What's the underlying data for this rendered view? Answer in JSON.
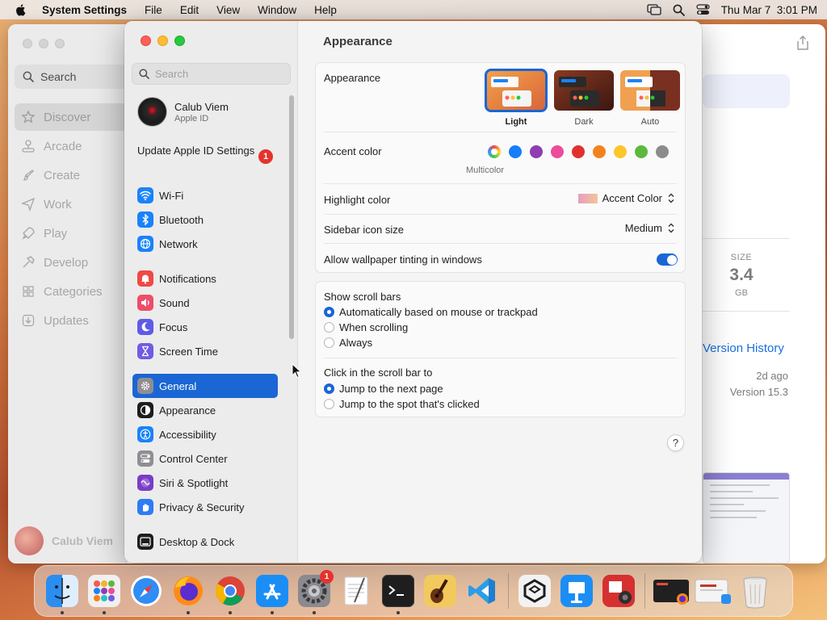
{
  "menubar": {
    "app_name": "System Settings",
    "menus": [
      "File",
      "Edit",
      "View",
      "Window",
      "Help"
    ],
    "clock": "Thu Mar 7  3:01 PM"
  },
  "appstore": {
    "search_label": "Search",
    "nav": [
      "Discover",
      "Arcade",
      "Create",
      "Work",
      "Play",
      "Develop",
      "Categories",
      "Updates"
    ],
    "selected_nav": "Discover",
    "user_name": "Calub Viem",
    "size_label": "SIZE",
    "size_value": "3.4",
    "size_unit": "GB",
    "version_history": "Version History",
    "updated_ago": "2d ago",
    "version": "Version 15.3"
  },
  "settings": {
    "search_placeholder": "Search",
    "profile_name": "Calub Viem",
    "profile_sub": "Apple ID",
    "update_text": "Update Apple ID Settings",
    "update_badge": "1",
    "sidebar_groups": [
      [
        {
          "label": "Wi-Fi",
          "icon": "wifi-icon",
          "color": "#1a82fb"
        },
        {
          "label": "Bluetooth",
          "icon": "bluetooth-icon",
          "color": "#1a82fb"
        },
        {
          "label": "Network",
          "icon": "globe-icon",
          "color": "#1a82fb"
        }
      ],
      [
        {
          "label": "Notifications",
          "icon": "bell-icon",
          "color": "#f04a44"
        },
        {
          "label": "Sound",
          "icon": "speaker-icon",
          "color": "#ef4c6a"
        },
        {
          "label": "Focus",
          "icon": "moon-icon",
          "color": "#5e5ce6"
        },
        {
          "label": "Screen Time",
          "icon": "hourglass-icon",
          "color": "#6e5ce6"
        }
      ],
      [
        {
          "label": "General",
          "icon": "gear-icon",
          "color": "#8e8e93",
          "selected": true
        },
        {
          "label": "Appearance",
          "icon": "appearance-icon",
          "color": "#1d1d1f"
        },
        {
          "label": "Accessibility",
          "icon": "accessibility-icon",
          "color": "#1a82fb"
        },
        {
          "label": "Control Center",
          "icon": "control-center-icon",
          "color": "#8e8e93"
        },
        {
          "label": "Siri & Spotlight",
          "icon": "siri-icon",
          "color": "#7a3cc7"
        },
        {
          "label": "Privacy & Security",
          "icon": "hand-icon",
          "color": "#2f7bf5"
        }
      ],
      [
        {
          "label": "Desktop & Dock",
          "icon": "dock-icon",
          "color": "#1d1d1f"
        }
      ]
    ],
    "title": "Appearance",
    "appearance_label": "Appearance",
    "themes": [
      {
        "label": "Light",
        "selected": true
      },
      {
        "label": "Dark",
        "selected": false
      },
      {
        "label": "Auto",
        "selected": false
      }
    ],
    "accent_label": "Accent color",
    "accent_colors": [
      "multicolor",
      "#147efb",
      "#8e3eb0",
      "#eb4c9b",
      "#e0312f",
      "#f4821c",
      "#fcc72b",
      "#5bb93e",
      "#8c8c8c"
    ],
    "multicolor_caption": "Multicolor",
    "highlight_label": "Highlight color",
    "highlight_value": "Accent Color",
    "icon_size_label": "Sidebar icon size",
    "icon_size_value": "Medium",
    "tinting_label": "Allow wallpaper tinting in windows",
    "tinting_on": true,
    "scrollbars_label": "Show scroll bars",
    "scrollbar_options": [
      {
        "label": "Automatically based on mouse or trackpad",
        "selected": true
      },
      {
        "label": "When scrolling",
        "selected": false
      },
      {
        "label": "Always",
        "selected": false
      }
    ],
    "click_label": "Click in the scroll bar to",
    "click_options": [
      {
        "label": "Jump to the next page",
        "selected": true
      },
      {
        "label": "Jump to the spot that's clicked",
        "selected": false
      }
    ],
    "help_label": "?"
  },
  "dock": {
    "apps": [
      {
        "name": "finder-icon",
        "bg": "#2a8ef0",
        "running": true
      },
      {
        "name": "launchpad-icon",
        "bg": "#f0f0f0",
        "running": true
      },
      {
        "name": "safari-icon",
        "bg": "#ffffff",
        "running": false
      },
      {
        "name": "firefox-icon",
        "bg": "#5b2ccf",
        "running": true
      },
      {
        "name": "chrome-icon",
        "bg": "#ffffff",
        "running": true
      },
      {
        "name": "app-store-icon",
        "bg": "#1a8ef5",
        "running": true
      },
      {
        "name": "system-settings-icon",
        "bg": "#8a8a8f",
        "running": true,
        "badge": "1"
      },
      {
        "name": "textedit-icon",
        "bg": "#f6f6f6",
        "running": false
      },
      {
        "name": "terminal-icon",
        "bg": "#1e1e1e",
        "running": true
      },
      {
        "name": "garageband-icon",
        "bg": "#f7d070",
        "running": false
      },
      {
        "name": "vscode-icon",
        "bg": "#ffffff",
        "running": false
      },
      {
        "name": "cube-app-icon",
        "bg": "#f2f2f2",
        "running": false
      },
      {
        "name": "keynote-icon",
        "bg": "#1a8ef5",
        "running": false
      },
      {
        "name": "photo-booth-icon",
        "bg": "#d63031",
        "running": false
      },
      {
        "name": "recent-window-icon",
        "bg": "#202020",
        "running": false
      },
      {
        "name": "finder-stack-icon",
        "bg": "#e8e8e8",
        "running": false
      },
      {
        "name": "trash-icon",
        "bg": "transparent",
        "running": false
      }
    ]
  }
}
